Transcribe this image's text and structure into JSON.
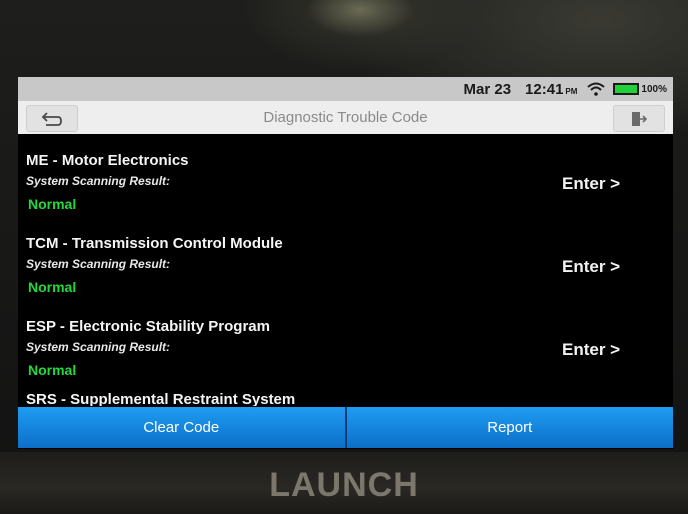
{
  "status": {
    "date": "Mar 23",
    "time": "12:41",
    "ampm": "PM",
    "battery_pct": "100%",
    "battery_color": "#1fd23a",
    "icons": [
      "wifi-icon",
      "battery-icon"
    ]
  },
  "header": {
    "title": "Diagnostic Trouble Code",
    "back_icon": "back-arrow-icon",
    "exit_icon": "exit-icon"
  },
  "systems": [
    {
      "name": "ME - Motor Electronics",
      "label": "System Scanning Result:",
      "status": "Normal",
      "action": "Enter >"
    },
    {
      "name": "TCM - Transmission Control Module",
      "label": "System Scanning Result:",
      "status": "Normal",
      "action": "Enter >"
    },
    {
      "name": "ESP - Electronic Stability Program",
      "label": "System Scanning Result:",
      "status": "Normal",
      "action": "Enter >"
    },
    {
      "name": "SRS - Supplemental Restraint System"
    }
  ],
  "footer": {
    "clear_code": "Clear Code",
    "report": "Report"
  },
  "device": {
    "brand": "LAUNCH"
  },
  "colors": {
    "normal_status": "#22d93c",
    "button_blue": "#1e9cf2"
  }
}
